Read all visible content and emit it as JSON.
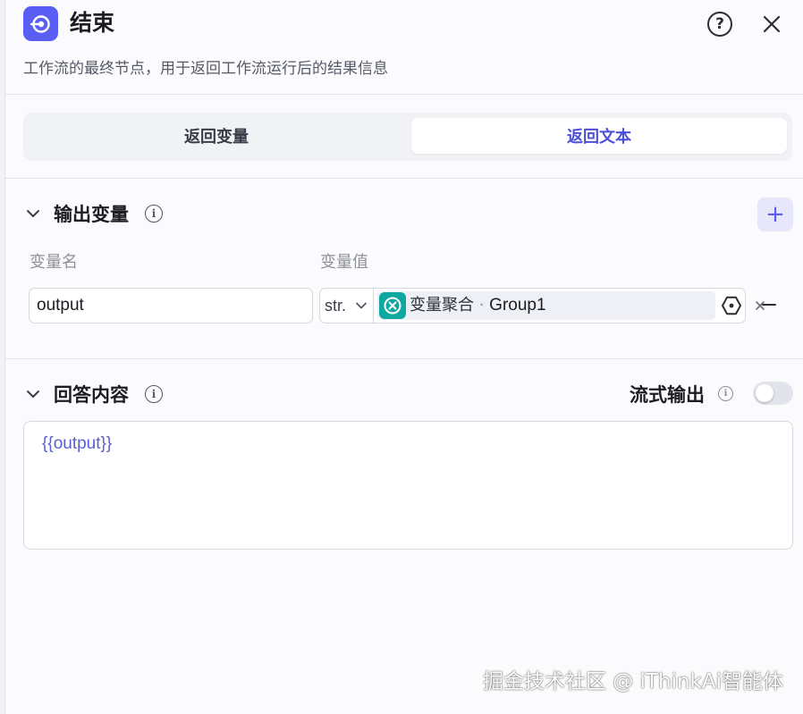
{
  "node": {
    "title": "结束",
    "description": "工作流的最终节点，用于返回工作流运行后的结果信息",
    "icon": "end-node-icon",
    "accent_color": "#5b5ef5"
  },
  "header_actions": {
    "help_glyph": "?",
    "help_icon": "question-circle-icon",
    "close_icon": "close-icon"
  },
  "mode_tabs": {
    "return_variables": "返回变量",
    "return_text": "返回文本",
    "selected": "返回文本"
  },
  "output_section": {
    "title": "输出变量",
    "info_glyph": "i",
    "add_glyph": "+",
    "columns": {
      "name": "变量名",
      "value": "变量值"
    },
    "rows": [
      {
        "name": "output",
        "type": "str.",
        "ref_node": "变量聚合",
        "ref_separator": " · ",
        "ref_var": "Group1",
        "ref_icon_color": "#0fa8a0"
      }
    ]
  },
  "answer_section": {
    "title": "回答内容",
    "info_glyph": "i",
    "stream_label": "流式输出",
    "stream_enabled": false,
    "content": "{{output}}"
  },
  "watermark": "掘金技术社区 @ iThinkAi智能体"
}
